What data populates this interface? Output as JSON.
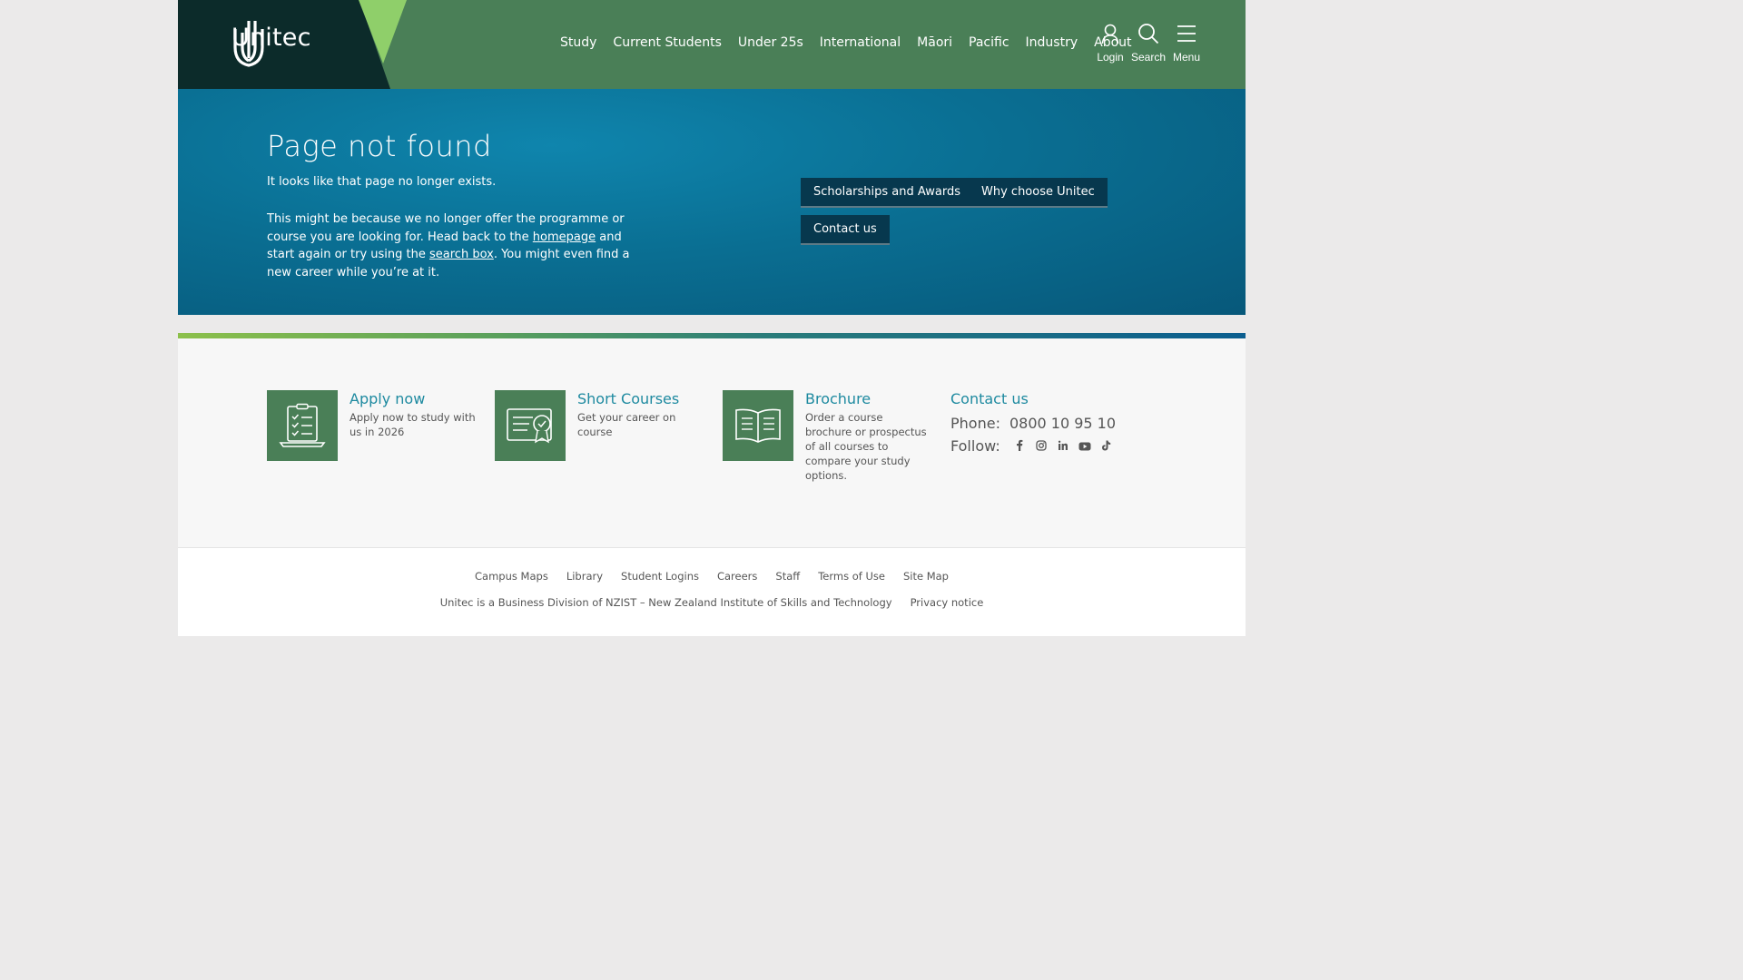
{
  "header": {
    "logo_text": "Unitec",
    "nav": [
      "Study",
      "Current Students",
      "Under 25s",
      "International",
      "Māori",
      "Pacific",
      "Industry",
      "About"
    ],
    "tools": {
      "login": "Login",
      "search": "Search",
      "menu": "Menu"
    }
  },
  "hero": {
    "title": "Page not found",
    "lead": "It looks like that page no longer exists.",
    "body_1": "This might be because we no longer offer the programme or course you are looking for. Head back to the ",
    "homepage_link": "homepage",
    "body_2": " and start again or try using the ",
    "search_link": "search box",
    "body_3": ". You might even find a new career while you’re at it.",
    "buttons": [
      "Scholarships and Awards",
      "Why choose Unitec",
      "Contact us"
    ]
  },
  "features": [
    {
      "icon": "laptop-checklist-icon",
      "title": "Apply now",
      "desc": "Apply now to study with us in 2026"
    },
    {
      "icon": "certificate-icon",
      "title": "Short Courses",
      "desc": "Get your career on course"
    },
    {
      "icon": "open-book-icon",
      "title": "Brochure",
      "desc": "Order a course brochure or prospectus of all courses to compare your study options."
    }
  ],
  "contact": {
    "title": "Contact us",
    "phone_label": "Phone:",
    "phone": "0800 10 95 10",
    "follow_label": "Follow:",
    "social": [
      "facebook-icon",
      "instagram-icon",
      "linkedin-icon",
      "youtube-icon",
      "tiktok-icon"
    ]
  },
  "footer": {
    "links": [
      "Campus Maps",
      "Library",
      "Student Logins",
      "Careers",
      "Staff",
      "Terms of Use",
      "Site Map"
    ],
    "division": "Unitec is a Business Division of NZIST – New Zealand Institute of Skills and Technology",
    "privacy": "Privacy notice"
  },
  "colors": {
    "header_green": "#4a7f57",
    "logo_dark": "#0c2b2a",
    "accent_lime": "#8fcf6a",
    "hero_blue": "#0a6f93",
    "button_navy": "#07384e",
    "link_teal": "#1e8aa0"
  }
}
